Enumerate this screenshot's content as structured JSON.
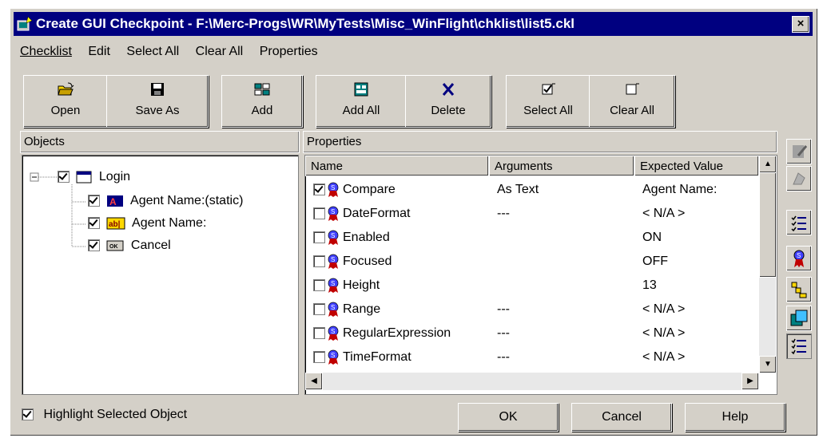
{
  "window": {
    "title": "Create GUI Checkpoint - F:\\Merc-Progs\\WR\\MyTests\\Misc_WinFlight\\chklist\\list5.ckl",
    "close_label": "×"
  },
  "menu": [
    "Checklist",
    "Edit",
    "Select All",
    "Clear All",
    "Properties"
  ],
  "toolbar": {
    "open": "Open",
    "save_as": "Save As",
    "add": "Add",
    "add_all": "Add All",
    "delete": "Delete",
    "select_all": "Select All",
    "clear_all": "Clear All"
  },
  "objects": {
    "header": "Objects",
    "tree": {
      "root": {
        "label": "Login",
        "checked": true,
        "expanded": true
      },
      "children": [
        {
          "label": "Agent Name:(static)",
          "checked": true,
          "icon": "static-text-icon"
        },
        {
          "label": "Agent Name:",
          "checked": true,
          "icon": "edit-field-icon"
        },
        {
          "label": "Cancel",
          "checked": true,
          "icon": "push-button-icon"
        }
      ]
    }
  },
  "properties": {
    "header": "Properties",
    "columns": [
      "Name",
      "Arguments",
      "Expected Value"
    ],
    "rows": [
      {
        "checked": true,
        "name": "Compare",
        "args": "As Text",
        "expected": "Agent Name:"
      },
      {
        "checked": false,
        "name": "DateFormat",
        "args": "---",
        "expected": "< N/A >"
      },
      {
        "checked": false,
        "name": "Enabled",
        "args": "",
        "expected": "ON"
      },
      {
        "checked": false,
        "name": "Focused",
        "args": "",
        "expected": "OFF"
      },
      {
        "checked": false,
        "name": "Height",
        "args": "",
        "expected": "13"
      },
      {
        "checked": false,
        "name": "Range",
        "args": "---",
        "expected": "< N/A >"
      },
      {
        "checked": false,
        "name": "RegularExpression",
        "args": "---",
        "expected": "< N/A >"
      },
      {
        "checked": false,
        "name": "TimeFormat",
        "args": "---",
        "expected": "< N/A >"
      }
    ]
  },
  "highlight": {
    "label": "Highlight Selected Object",
    "checked": true
  },
  "buttons": {
    "ok": "OK",
    "cancel": "Cancel",
    "help": "Help"
  },
  "side_tools": [
    "edit-expected-value-icon",
    "edit-arguments-icon",
    "show-selected-properties-icon",
    "show-standard-properties-icon",
    "show-nonstandard-properties-icon",
    "show-user-properties-icon",
    "show-all-properties-icon"
  ],
  "colors": {
    "titlebar": "#000080",
    "face": "#d4d0c8"
  }
}
